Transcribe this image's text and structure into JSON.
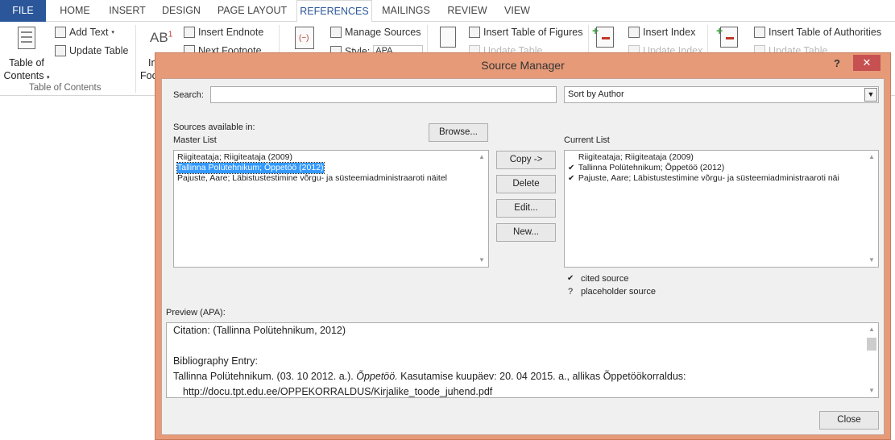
{
  "ribbon": {
    "tabs": [
      "FILE",
      "HOME",
      "INSERT",
      "DESIGN",
      "PAGE LAYOUT",
      "REFERENCES",
      "MAILINGS",
      "REVIEW",
      "VIEW"
    ],
    "active_tab": "REFERENCES",
    "toc": {
      "label_line1": "Table of",
      "label_line2": "Contents",
      "add_text": "Add Text",
      "update_table": "Update Table",
      "group_label": "Table of Contents"
    },
    "footnotes": {
      "ab_icon": "AB",
      "ab_sup": "1",
      "insert_label_part": "In",
      "foot_label_part": "Foo",
      "insert_endnote": "Insert Endnote",
      "next_footnote": "Next Footnote"
    },
    "citations": {
      "manage_sources": "Manage Sources",
      "style_label": "Style:",
      "style_value": "APA"
    },
    "captions": {
      "insert_table_of_figures": "Insert Table of Figures",
      "update_table": "Update Table"
    },
    "index": {
      "insert_index": "Insert Index",
      "update_index": "Update Index"
    },
    "authorities": {
      "insert_table_of_authorities": "Insert Table of Authorities",
      "update_table": "Update Table"
    }
  },
  "dialog": {
    "title": "Source Manager",
    "help_label": "?",
    "close_x": "✕",
    "search_label": "Search:",
    "search_value": "",
    "sort_value": "Sort by Author",
    "sources_available_label": "Sources available in:",
    "master_list_label": "Master List",
    "browse_button": "Browse...",
    "current_list_label": "Current List",
    "master_list": [
      "Riigiteataja; Riigiteataja (2009)",
      "Tallinna Polütehnikum; Õppetöö (2012)",
      "Pajuste, Aare; Läbistustestimine võrgu- ja süsteemiadministraaroti näitel"
    ],
    "master_selected_index": 1,
    "current_list": [
      {
        "check": "",
        "text": "Riigiteataja; Riigiteataja (2009)"
      },
      {
        "check": "✔",
        "text": "Tallinna Polütehnikum; Õppetöö (2012)"
      },
      {
        "check": "✔",
        "text": "Pajuste, Aare; Läbistustestimine võrgu- ja süsteemiadministraaroti näi"
      }
    ],
    "buttons": {
      "copy": "Copy ->",
      "delete": "Delete",
      "edit": "Edit...",
      "new": "New...",
      "close": "Close"
    },
    "legend": {
      "cited_mark": "✔",
      "cited_label": "cited source",
      "placeholder_mark": "?",
      "placeholder_label": "placeholder source"
    },
    "preview_label": "Preview (APA):",
    "preview": {
      "citation": "Citation:  (Tallinna Polütehnikum, 2012)",
      "bibliography_heading": "Bibliography Entry:",
      "entry_prefix": "Tallinna Polütehnikum. (03. 10 2012. a.). ",
      "entry_title": "Õppetöö.",
      "entry_suffix": " Kasutamise kuupäev: 20. 04 2015. a., allikas Õppetöökorraldus:",
      "entry_url": "http://docu.tpt.edu.ee/OPPEKORRALDUS/Kirjalike_toode_juhend.pdf"
    }
  },
  "colors": {
    "file_tab": "#2b579a",
    "dialog_frame": "#e69a78",
    "close_button": "#c75050",
    "selection": "#3399ff"
  }
}
